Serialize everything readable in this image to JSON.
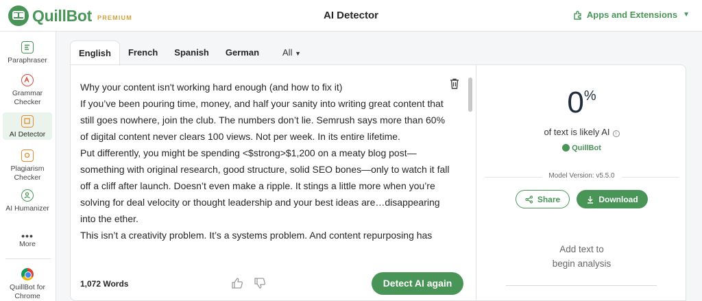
{
  "header": {
    "brand": "QuillBot",
    "tier": "PREMIUM",
    "title": "AI Detector",
    "apps_label": "Apps and Extensions"
  },
  "sidebar": {
    "items": [
      {
        "label": "Paraphraser"
      },
      {
        "label": "Grammar Checker"
      },
      {
        "label": "AI Detector",
        "active": true
      },
      {
        "label": "Plagiarism Checker"
      },
      {
        "label": "AI Humanizer"
      },
      {
        "label": "More"
      },
      {
        "label": "QuillBot for Chrome"
      }
    ]
  },
  "tabs": [
    {
      "label": "English",
      "active": true
    },
    {
      "label": "French"
    },
    {
      "label": "Spanish"
    },
    {
      "label": "German"
    },
    {
      "label": "All"
    }
  ],
  "editor": {
    "paragraphs": [
      "Why your content isn't working hard enough (and how to fix it)",
      "If you’ve been pouring time, money, and half your sanity into writing great content that still goes nowhere, join the club. The numbers don’t lie. Semrush says more than 60% of digital content never clears 100 views. Not per week. In its entire lifetime.",
      "Put differently, you might be spending <$strong>$1,200 on a meaty blog post—something with original research, good structure, solid SEO bones—only to watch it fall off a cliff after launch. Doesn’t even make a ripple. It stings a little more when you’re solving for deal velocity or thought leadership and your best ideas are…disappearing into the ether.",
      "This isn’t a creativity problem. It’s a systems problem. And content repurposing has"
    ],
    "word_count": "1,072 Words",
    "detect_label": "Detect AI again"
  },
  "result": {
    "percent": "0",
    "percent_sign": "%",
    "likely_label": "of text is likely AI",
    "brand_small": "QuillBot",
    "model_version": "Model Version: v5.5.0",
    "share_label": "Share",
    "download_label": "Download",
    "empty_line1": "Add text to",
    "empty_line2": "begin analysis"
  },
  "colors": {
    "brand_green": "#499557",
    "premium_gold": "#d3a13a"
  }
}
